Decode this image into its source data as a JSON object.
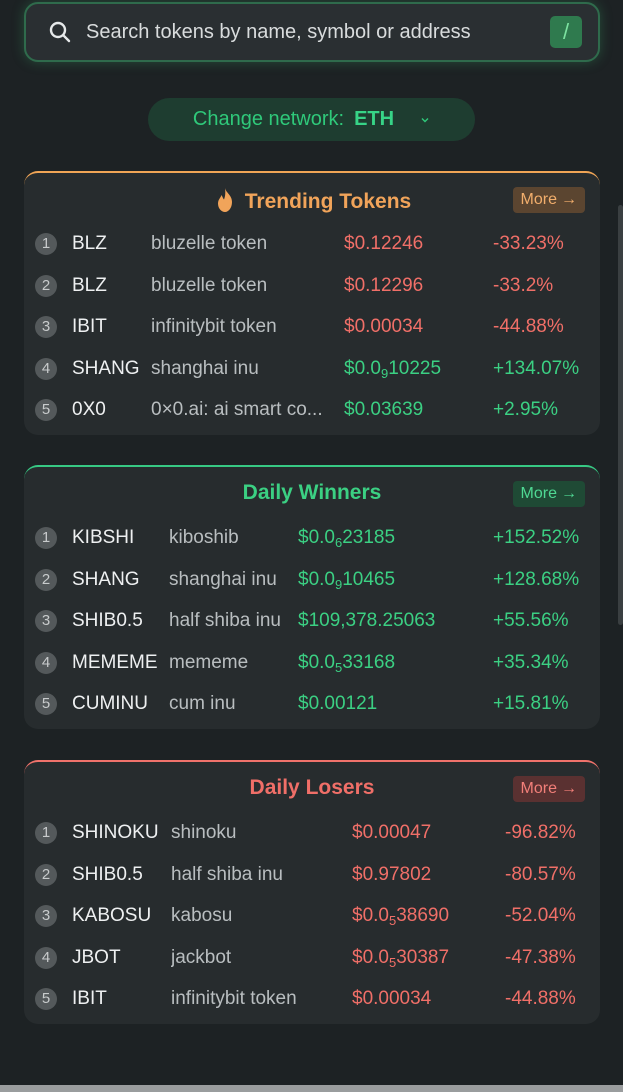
{
  "search": {
    "placeholder": "Search tokens by name, symbol or address",
    "shortcut": "/"
  },
  "network": {
    "label": "Change network:",
    "value": "ETH"
  },
  "trending": {
    "title": "Trending Tokens",
    "more": "More",
    "rows": [
      {
        "rank": "1",
        "symbol": "BLZ",
        "name": "bluzelle token",
        "price": "$0.12246",
        "change": "-33.23%"
      },
      {
        "rank": "2",
        "symbol": "BLZ",
        "name": "bluzelle token",
        "price": "$0.12296",
        "change": "-33.2%"
      },
      {
        "rank": "3",
        "symbol": "IBIT",
        "name": "infinitybit token",
        "price": "$0.00034",
        "change": "-44.88%"
      },
      {
        "rank": "4",
        "symbol": "SHANG",
        "name": "shanghai inu",
        "price_pre": "$0.0",
        "price_sub": "9",
        "price_post": "10225",
        "change": "+134.07%"
      },
      {
        "rank": "5",
        "symbol": "0X0",
        "name": "0×0.ai: ai smart co...",
        "price": "$0.03639",
        "change": "+2.95%"
      }
    ]
  },
  "winners": {
    "title": "Daily Winners",
    "more": "More",
    "rows": [
      {
        "rank": "1",
        "symbol": "KIBSHI",
        "name": "kiboshib",
        "price_pre": "$0.0",
        "price_sub": "6",
        "price_post": "23185",
        "change": "+152.52%"
      },
      {
        "rank": "2",
        "symbol": "SHANG",
        "name": "shanghai inu",
        "price_pre": "$0.0",
        "price_sub": "9",
        "price_post": "10465",
        "change": "+128.68%"
      },
      {
        "rank": "3",
        "symbol": "SHIB0.5",
        "name": "half shiba inu",
        "price": "$109,378.25063",
        "change": "+55.56%"
      },
      {
        "rank": "4",
        "symbol": "MEMEME",
        "name": "mememe",
        "price_pre": "$0.0",
        "price_sub": "5",
        "price_post": "33168",
        "change": "+35.34%"
      },
      {
        "rank": "5",
        "symbol": "CUMINU",
        "name": "cum inu",
        "price": "$0.00121",
        "change": "+15.81%"
      }
    ]
  },
  "losers": {
    "title": "Daily Losers",
    "more": "More",
    "rows": [
      {
        "rank": "1",
        "symbol": "SHINOKU",
        "name": "shinoku",
        "price": "$0.00047",
        "change": "-96.82%"
      },
      {
        "rank": "2",
        "symbol": "SHIB0.5",
        "name": "half shiba inu",
        "price": "$0.97802",
        "change": "-80.57%"
      },
      {
        "rank": "3",
        "symbol": "KABOSU",
        "name": "kabosu",
        "price_pre": "$0.0",
        "price_sub": "5",
        "price_post": "38690",
        "change": "-52.04%"
      },
      {
        "rank": "4",
        "symbol": "JBOT",
        "name": "jackbot",
        "price_pre": "$0.0",
        "price_sub": "5",
        "price_post": "30387",
        "change": "-47.38%"
      },
      {
        "rank": "5",
        "symbol": "IBIT",
        "name": "infinitybit token",
        "price": "$0.00034",
        "change": "-44.88%"
      }
    ]
  },
  "colors": {
    "up": "#3bd083",
    "down": "#f06f68",
    "trending_accent": "#f1a45a"
  }
}
